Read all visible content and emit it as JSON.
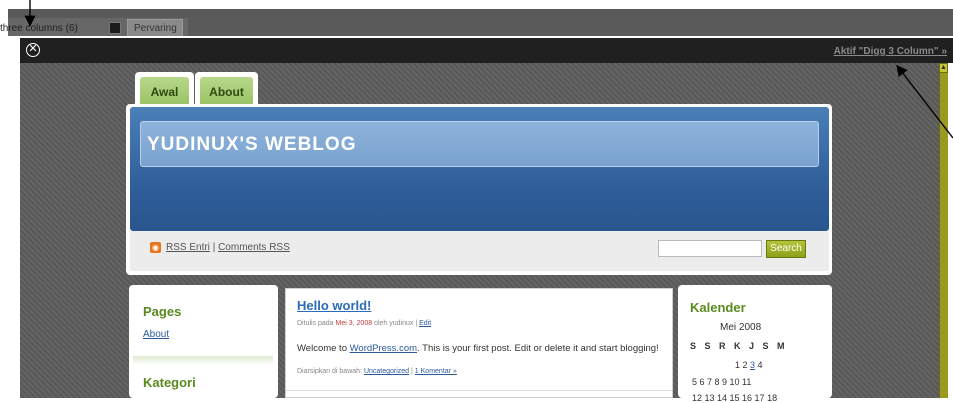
{
  "outer": {
    "theme_label": "three columns (6)",
    "preview_tab": "Pervaring"
  },
  "modal": {
    "close_symbol": "✕",
    "activate_link": "Aktif \"Digg 3 Column\" »"
  },
  "site": {
    "tabs": [
      "Awal",
      "About"
    ],
    "title": "YUDINUX'S WEBLOG",
    "rss_entries": "RSS Entri",
    "separator": "|",
    "comments_rss": "Comments RSS",
    "search_button": "Search",
    "search_value": ""
  },
  "sidebar_left": {
    "pages_title": "Pages",
    "pages_link": "About",
    "categories_title": "Kategori"
  },
  "post": {
    "title": "Hello world!",
    "meta_prefix": "Ditulis pada ",
    "meta_date": "Mei 3, 2008",
    "meta_by": " oleh yudinux | ",
    "meta_edit": "Edit",
    "body_prefix": "Welcome to ",
    "body_link": "WordPress.com",
    "body_suffix": ". This is your first post. Edit or delete it and start blogging!",
    "footer_prefix": "Diarsipkan di bawah: ",
    "footer_category": "Uncategorized",
    "footer_sep": " | ",
    "footer_comment": "1 Komentar »"
  },
  "calendar": {
    "title": "Kalender",
    "month": "Mei 2008",
    "weekdays": "S S R K J S M",
    "row1_prefix": "1  2  ",
    "row1_link": "3",
    "row1_suffix": "  4",
    "row2": "5  6  7  8  9  10 11",
    "row3": "12 13 14 15 16 17 18"
  },
  "colors": {
    "modal_bar": "#202020",
    "accent_green": "#5a8a1e",
    "header_blue": "#2d5c97",
    "scrollbar": "#9a9a22"
  }
}
